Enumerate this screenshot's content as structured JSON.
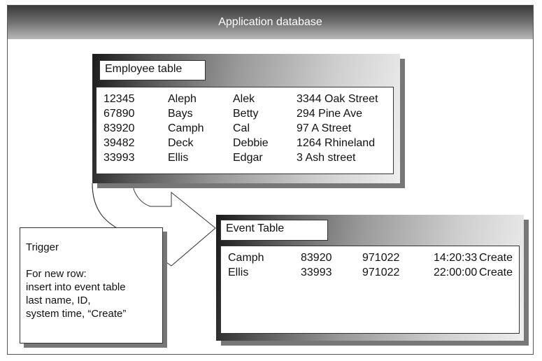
{
  "banner": {
    "title": "Application database"
  },
  "employee_table": {
    "title": "Employee table",
    "rows": [
      [
        "12345",
        "Aleph",
        "Alek",
        "3344 Oak Street"
      ],
      [
        "67890",
        "Bays",
        "Betty",
        "294 Pine Ave"
      ],
      [
        "83920",
        "Camph",
        "Cal",
        "97 A Street"
      ],
      [
        "39482",
        "Deck",
        "Debbie",
        "1264 Rhineland"
      ],
      [
        "33993",
        "Ellis",
        "Edgar",
        "3 Ash street"
      ]
    ]
  },
  "event_table": {
    "title": "Event Table",
    "rows": [
      [
        "Camph",
        "83920",
        "971022",
        "14:20:33",
        "Create"
      ],
      [
        "Ellis",
        "33993",
        "971022",
        "22:00:00",
        "Create"
      ]
    ]
  },
  "trigger": {
    "heading": "Trigger",
    "lines": [
      "For new row:",
      "insert into event table",
      "last name, ID,",
      "system time, “Create”"
    ]
  }
}
